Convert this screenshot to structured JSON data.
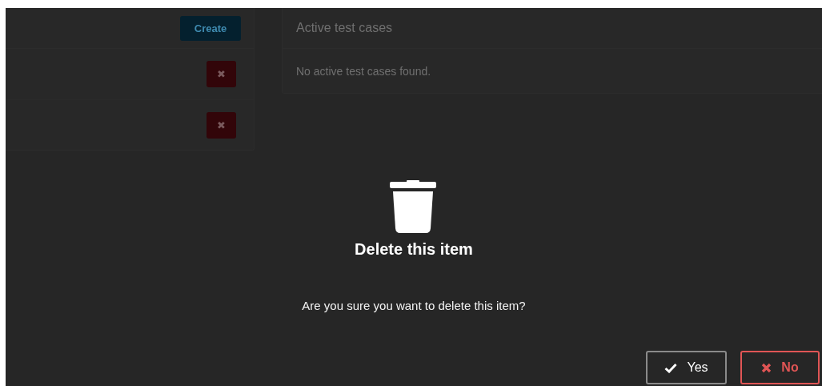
{
  "background_page": {
    "left_panel": {
      "create_button": "Create",
      "rows": [
        {
          "delete_button": "✖"
        },
        {
          "delete_button": "✖"
        }
      ]
    },
    "right_panel": {
      "title": "Active test cases",
      "empty_message": "No active test cases found."
    }
  },
  "dialog": {
    "title": "Delete this item",
    "message": "Are you sure you want to delete this item?",
    "buttons": [
      {
        "kind": "confirm",
        "label": "Yes"
      },
      {
        "kind": "cancel",
        "label": "No"
      }
    ]
  }
}
